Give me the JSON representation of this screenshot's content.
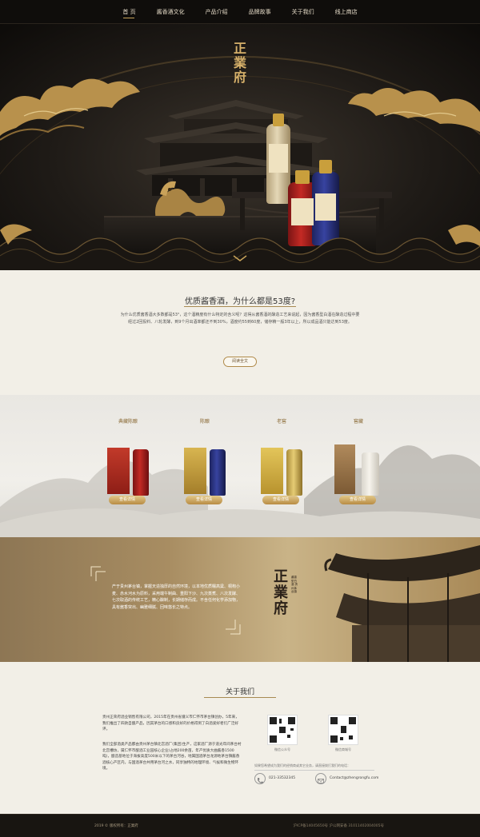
{
  "nav": {
    "items": [
      {
        "label": "首 页"
      },
      {
        "label": "酱香酒文化"
      },
      {
        "label": "产品介绍"
      },
      {
        "label": "品牌故事"
      },
      {
        "label": "关于我们"
      },
      {
        "label": "线上商店"
      }
    ],
    "active_index": 0
  },
  "hero": {
    "logo_text": "正業府",
    "scroll_icon": "chevron-down-icon"
  },
  "intro": {
    "title": "优质酱香酒，为什么都是53度?",
    "body": "为什么优质酱香酒大多数都是53°，这个酒精度有什么特定的含义呢？这得从酱香酒的酿造工艺来说起，因为酱香型白酒在酿造过程中要经过2回投料、八轮发酵，到9个月出酒率都还不到30%，酒度约55到60度，储存精一般3年以上，所以成品酒只能达到53度。",
    "button_label": "阅读全文"
  },
  "products": {
    "items": [
      {
        "name": "典藏陈酿",
        "button": "查看详情"
      },
      {
        "name": "陈酿",
        "button": "查看详情"
      },
      {
        "name": "老窖",
        "button": "查看详情"
      },
      {
        "name": "窖藏",
        "button": "查看详情"
      }
    ]
  },
  "origin": {
    "text": "产于贵州茅台镇，掌握天造独厚的自然环境，以本地优质糯高粱、桐枸小麦、赤水河水为原料，采用端午制曲、重阳下沙、九次蒸煮、八次发酵、七次取酒的传统工艺，精心酿制，长期储存而成。不含任何化学添加物，具有酱香突出、幽雅细腻、回味悠长之特点。",
    "logo_text": "正業府",
    "vertical_text": "酱香型白酒 贵州茅台镇"
  },
  "about": {
    "title": "关于我们",
    "para1": "贵州正荣府酒业销售有限公司，2015年在贵州省遵义市仁怀市茅台镇创办，5年来，我们推出了四款自酿产品，因其茅台的口感和良好的价格得到了白酒爱好者们广泛好评。",
    "para2": "我们全部酒类产品都由贵州茅台镇北宫酒厂(集团)生产，这家酒厂源于道光年间茅台村北宫槽坊，属仁怀市酿酒工业园核心企业(占地200余亩，年产优质大曲酱香1500吨)，酿造基地位于海拔高度500米以下的茅台河谷，地属国酒茅台龙源地茅台镇酱香酒核心产区内，与国酒茅台共用茅台河之水，同享独特的地理环境、气候和微生物环境。",
    "qr": [
      {
        "label": "微信公众号"
      },
      {
        "label": "微信商城号"
      }
    ],
    "contact_note": "如果您希望成为我们的经销商或其它业务，请直接拨打我们的电话：",
    "phone": "021-33532345",
    "email": "Contact@zhengrongfu.com"
  },
  "footer": {
    "copyright": "2019 © 版权所有：正業府",
    "icp": "沪ICP备14045650号   沪公网安备 31011402004005号"
  },
  "colors": {
    "gold": "#c8a35a",
    "dark": "#1a1714",
    "cream": "#f2efe7"
  }
}
